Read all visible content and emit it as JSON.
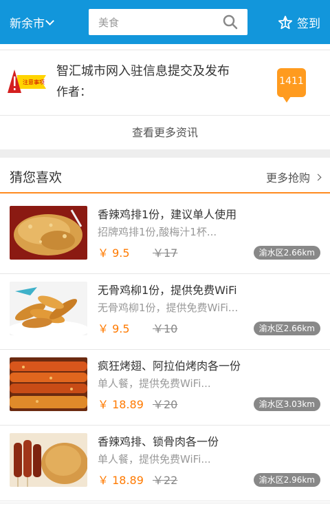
{
  "header": {
    "city": "新余市",
    "search_placeholder": "美食",
    "signin_label": "签到"
  },
  "news": {
    "title": "智汇城市网入驻信息提交及发布",
    "author": "作者：",
    "badge_count": "1411",
    "thumb_label": "注意事项",
    "more_label": "查看更多资讯"
  },
  "guess": {
    "heading": "猜您喜欢",
    "more_label": "更多抢购"
  },
  "items": [
    {
      "name": "香辣鸡排1份，建议单人使用",
      "desc": "招牌鸡排1份,酸梅汁1杯...",
      "price": "￥ 9.5",
      "old_price": "￥17",
      "distance": "渝水区2.66km"
    },
    {
      "name": "无骨鸡柳1份，提供免费WiFi",
      "desc": "无骨鸡柳1份，提供免费WiFi...",
      "price": "￥ 9.5",
      "old_price": "￥10",
      "distance": "渝水区2.66km"
    },
    {
      "name": "疯狂烤翅、阿拉伯烤肉各一份",
      "desc": "单人餐，提供免费WiFi...",
      "price": "￥ 18.89",
      "old_price": "￥20",
      "distance": "渝水区3.03km"
    },
    {
      "name": "香辣鸡排、锁骨肉各一份",
      "desc": "单人餐，提供免费WiFi...",
      "price": "￥ 18.89",
      "old_price": "￥22",
      "distance": "渝水区2.96km"
    }
  ],
  "colors": {
    "primary": "#1296db",
    "accent": "#ff8a1f",
    "price": "#ff7a00"
  }
}
